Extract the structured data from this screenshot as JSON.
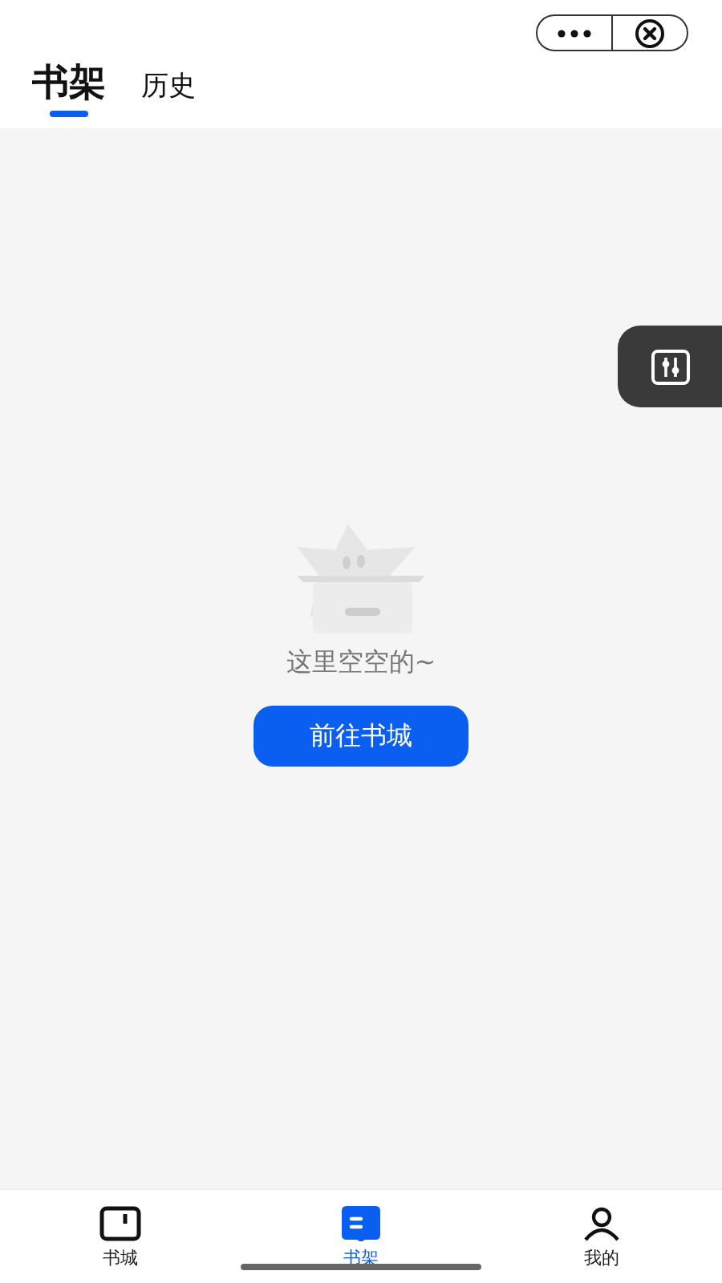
{
  "header_tabs": [
    {
      "label": "书架",
      "selected": true
    },
    {
      "label": "历史",
      "selected": false
    }
  ],
  "empty_state": {
    "message": "这里空空的~",
    "button": "前往书城"
  },
  "bottom_nav": [
    {
      "label": "书城",
      "kind": "store",
      "selected": false
    },
    {
      "label": "书架",
      "kind": "shelf",
      "selected": true
    },
    {
      "label": "我的",
      "kind": "profile",
      "selected": false
    }
  ]
}
